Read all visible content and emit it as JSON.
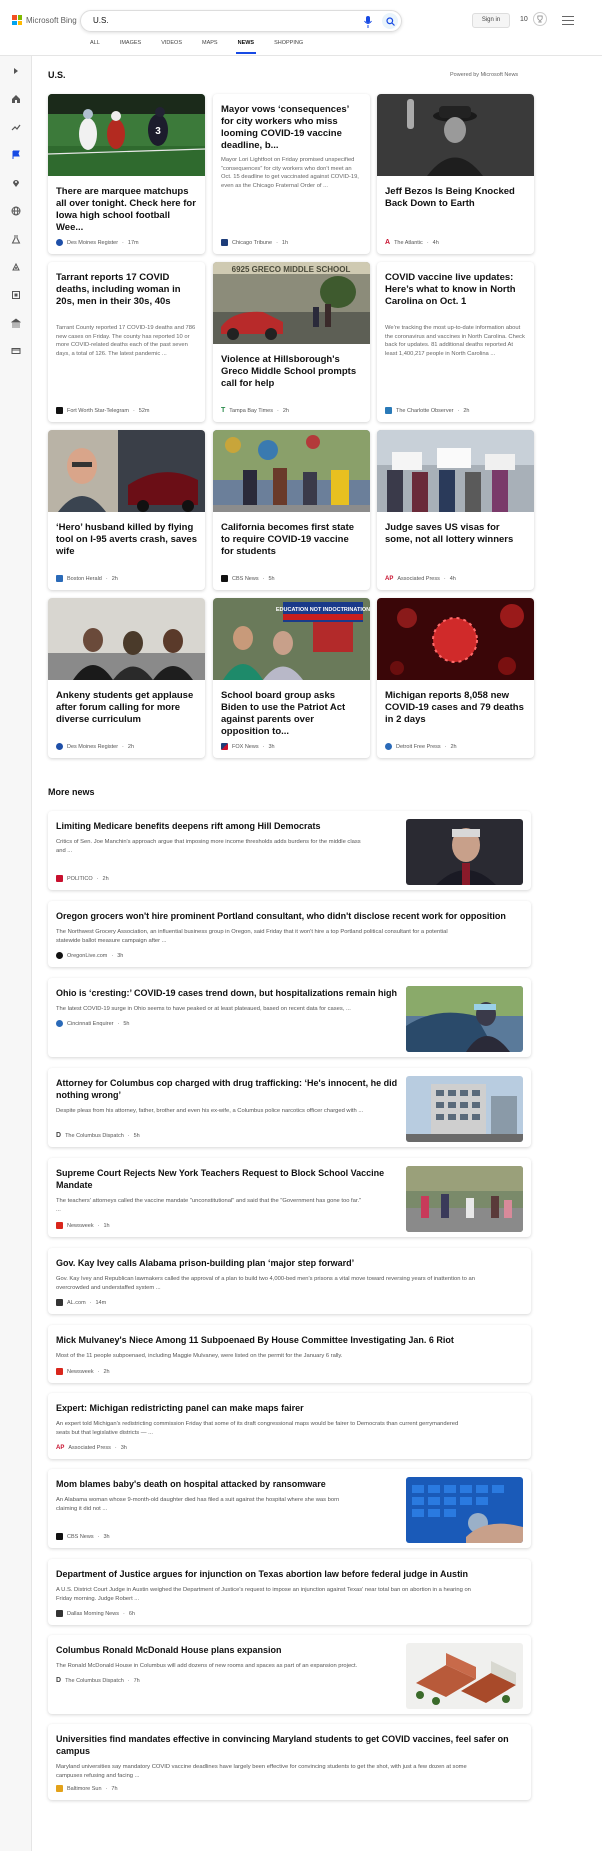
{
  "header": {
    "logo_text": "Microsoft Bing",
    "search_value": "U.S.",
    "sign_in": "Sign in",
    "points": "10",
    "tabs": [
      "ALL",
      "IMAGES",
      "VIDEOS",
      "MAPS",
      "NEWS",
      "SHOPPING"
    ],
    "active_tab": "NEWS"
  },
  "main": {
    "section_title": "U.S.",
    "powered_by": "Powered by Microsoft News",
    "more_news_title": "More news"
  },
  "cards": [
    {
      "title": "There are marquee matchups all over tonight. Check here for Iowa high school football Wee...",
      "snippet": "",
      "source": "Des Moines Register",
      "time": "17m",
      "src_color": "#1e4fa8",
      "image": "football"
    },
    {
      "title": "Mayor vows ‘consequences’ for city workers who miss looming COVID-19 vaccine deadline, b...",
      "snippet": "Mayor Lori Lightfoot on Friday promised unspecified “consequences” for city workers who don't meet an Oct. 15 deadline to get vaccinated against COVID-19, even as the Chicago Fraternal Order of ...",
      "source": "Chicago Tribune",
      "time": "1h",
      "src_color": "#1e3d7a",
      "image": ""
    },
    {
      "title": "Jeff Bezos Is Being Knocked Back Down to Earth",
      "snippet": "",
      "source": "The Atlantic",
      "time": "4h",
      "src_color": "#c8102e",
      "image": "bezos"
    },
    {
      "title": "Tarrant reports 17 COVID deaths, including woman in 20s, men in their 30s, 40s",
      "snippet": "Tarrant County reported 17 COVID-19 deaths and 786 new cases on Friday. The county has reported 10 or more COVID-related deaths each of the past seven days, a total of 126. The latest pandemic ...",
      "source": "Fort Worth Star-Telegram",
      "time": "52m",
      "src_color": "#111111",
      "image": ""
    },
    {
      "title": "Violence at Hillsborough's Greco Middle School prompts call for help",
      "snippet": "",
      "source": "Tampa Bay Times",
      "time": "2h",
      "src_color": "#2a8a4a",
      "image": "school"
    },
    {
      "title": "COVID vaccine live updates: Here’s what to know in North Carolina on Oct. 1",
      "snippet": "We’re tracking the most up-to-date information about the coronavirus and vaccines in North Carolina. Check back for updates. 81 additional deaths reported At least 1,400,217 people in North Carolina ...",
      "source": "The Charlotte Observer",
      "time": "2h",
      "src_color": "#2a7ab8",
      "image": ""
    },
    {
      "title": "‘Hero’ husband killed by flying tool on I-95 averts crash, saves wife",
      "snippet": "",
      "source": "Boston Herald",
      "time": "2h",
      "src_color": "#2a6ab8",
      "image": "hero"
    },
    {
      "title": "California becomes first state to require COVID-19 vaccine for students",
      "snippet": "",
      "source": "CBS News",
      "time": "5h",
      "src_color": "#111111",
      "image": "california"
    },
    {
      "title": "Judge saves US visas for some, not all lottery winners",
      "snippet": "",
      "source": "Associated Press",
      "time": "4h",
      "src_color": "#c8102e",
      "image": "visas"
    },
    {
      "title": "Ankeny students get applause after forum calling for more diverse curriculum",
      "snippet": "",
      "source": "Des Moines Register",
      "time": "2h",
      "src_color": "#1e4fa8",
      "image": "ankeny"
    },
    {
      "title": "School board group asks Biden to use the Patriot Act against parents over opposition to...",
      "snippet": "",
      "source": "FOX News",
      "time": "3h",
      "src_color": "#1e3d7a",
      "image": "schoolboard"
    },
    {
      "title": "Michigan reports 8,058 new COVID-19 cases and 79 deaths in 2 days",
      "snippet": "",
      "source": "Detroit Free Press",
      "time": "2h",
      "src_color": "#2a6ab8",
      "image": "virus"
    }
  ],
  "more_news": [
    {
      "title": "Limiting Medicare benefits deepens rift among Hill Democrats",
      "snippet": [
        "Critics of Sen. Joe Manchin's approach argue that imposing more income thresholds adds burdens for the middle class",
        "and ..."
      ],
      "source": "POLITICO",
      "time": "2h",
      "src_color": "#c8102e",
      "thumb": "manchin"
    },
    {
      "title": "Oregon grocers won't hire prominent Portland consultant, who didn't disclose recent work for opposition",
      "snippet": [
        "The Northwest Grocery Association, an influential business group in Oregon, said Friday that it won't hire a top Portland political consultant for a potential",
        "statewide ballot measure campaign after ..."
      ],
      "source": "OregonLive.com",
      "time": "3h",
      "src_color": "#111111",
      "thumb": ""
    },
    {
      "title": "Ohio is ‘cresting:’ COVID-19 cases trend down, but hospitalizations remain high",
      "snippet": [
        "The latest COVID-19 surge in Ohio seems to have peaked or at least plateaued, based on recent data for cases, ..."
      ],
      "source": "Cincinnati Enquirer",
      "time": "5h",
      "src_color": "#2a6ab8",
      "thumb": "ohio"
    },
    {
      "title": "Attorney for Columbus cop charged with drug trafficking: ‘He's innocent, he did",
      "title2": "nothing wrong’",
      "snippet": [
        "Despite pleas from his attorney, father, brother and even his ex-wife, a Columbus police narcotics officer charged with ..."
      ],
      "source": "The Columbus Dispatch",
      "time": "5h",
      "src_color": "#444444",
      "thumb": "building"
    },
    {
      "title": "Supreme Court Rejects New York Teachers Request to Block School Vaccine",
      "title2": "Mandate",
      "snippet": [
        "The teachers' attorneys called the vaccine mandate \"unconstitutional\" and said that the \"Government has gone too far.\"",
        "..."
      ],
      "source": "Newsweek",
      "time": "1h",
      "src_color": "#d9261c",
      "thumb": "protest"
    },
    {
      "title": "Gov. Kay Ivey calls Alabama prison-building plan ‘major step forward’",
      "snippet": [
        "Gov. Kay Ivey and Republican lawmakers called the approval of a plan to build two 4,000-bed men's prisons a vital move toward reversing years of inattention to an",
        "overcrowded and understaffed system ..."
      ],
      "source": "AL.com",
      "time": "14m",
      "src_color": "#333333",
      "thumb": ""
    },
    {
      "title": "Mick Mulvaney's Niece Among 11 Subpoenaed By House Committee Investigating Jan. 6 Riot",
      "snippet": [
        "Most of the 11 people subpoenaed, including Maggie Mulvaney, were listed on the permit for the January 6 rally."
      ],
      "source": "Newsweek",
      "time": "2h",
      "src_color": "#d9261c",
      "thumb": ""
    },
    {
      "title": "Expert: Michigan redistricting panel can make maps fairer",
      "snippet": [
        "An expert told Michigan's redistricting commission Friday that some of its draft congressional maps would be fairer to Democrats than current gerrymandered",
        "seats but that legislative districts — ..."
      ],
      "source": "Associated Press",
      "time": "3h",
      "src_color": "#c8102e",
      "thumb": ""
    },
    {
      "title": "Mom blames baby's death on hospital attacked by ransomware",
      "snippet": [
        "An Alabama woman whose 9-month-old daughter died has filed a suit against the hospital where she was born",
        "claiming it did not ..."
      ],
      "source": "CBS News",
      "time": "3h",
      "src_color": "#111111",
      "thumb": "keyboard"
    },
    {
      "title": "Department of Justice argues for injunction on Texas abortion law before federal judge in Austin",
      "snippet": [
        "A U.S. District Court Judge in Austin weighed the Department of Justice's request to impose an injunction against Texas' near total ban on abortion in a hearing on",
        "Friday morning. Judge Robert ..."
      ],
      "source": "Dallas Morning News",
      "time": "6h",
      "src_color": "#333333",
      "thumb": ""
    },
    {
      "title": "Columbus Ronald McDonald House plans expansion",
      "snippet": [
        "The Ronald McDonald House in Columbus will add dozens of new rooms and spaces as part of an expansion project."
      ],
      "source": "The Columbus Dispatch",
      "time": "7h",
      "src_color": "#444444",
      "thumb": "houses"
    },
    {
      "title": "Universities find mandates effective in convincing Maryland students to get COVID vaccines, feel safer on",
      "title2": "campus",
      "snippet": [
        "Maryland universities say mandatory COVID vaccine deadlines have largely been effective for convincing students to get the shot, with just a few dozen at some",
        "campuses refusing and facing ..."
      ],
      "source": "Baltimore Sun",
      "time": "7h",
      "src_color": "#e3a21a",
      "thumb": ""
    }
  ],
  "colors": {
    "accent": "#174ae4",
    "rail_bg": "#f7f7f7"
  }
}
